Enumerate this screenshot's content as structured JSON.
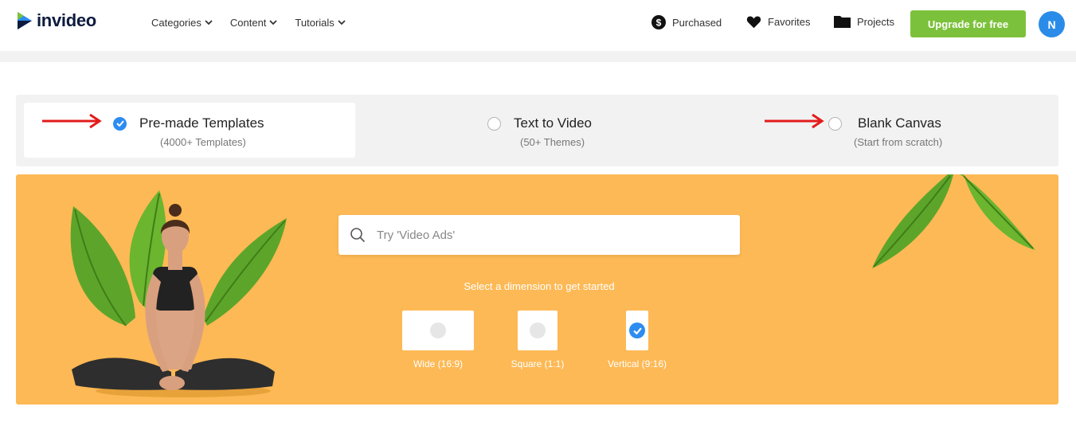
{
  "header": {
    "logo_text": "invideo",
    "nav": [
      {
        "label": "Categories"
      },
      {
        "label": "Content"
      },
      {
        "label": "Tutorials"
      }
    ],
    "purchased_label": "Purchased",
    "favorites_label": "Favorites",
    "projects_label": "Projects",
    "upgrade_label": "Upgrade for free",
    "avatar_initial": "N"
  },
  "modes": {
    "selected": "premade",
    "premade": {
      "title": "Pre-made Templates",
      "subtitle": "(4000+ Templates)"
    },
    "text_to_video": {
      "title": "Text to Video",
      "subtitle": "(50+ Themes)"
    },
    "blank": {
      "title": "Blank Canvas",
      "subtitle": "(Start from scratch)"
    }
  },
  "search": {
    "placeholder": "Try 'Video Ads'"
  },
  "dimensions": {
    "prompt": "Select a dimension to get started",
    "selected": "vertical",
    "wide": "Wide (16:9)",
    "square": "Square (1:1)",
    "vertical": "Vertical (9:16)"
  },
  "colors": {
    "brand_green": "#7cc13b",
    "banner": "#fdb955",
    "accent_blue": "#2d8cf0",
    "annotation_arrow": "#e31b1b"
  }
}
